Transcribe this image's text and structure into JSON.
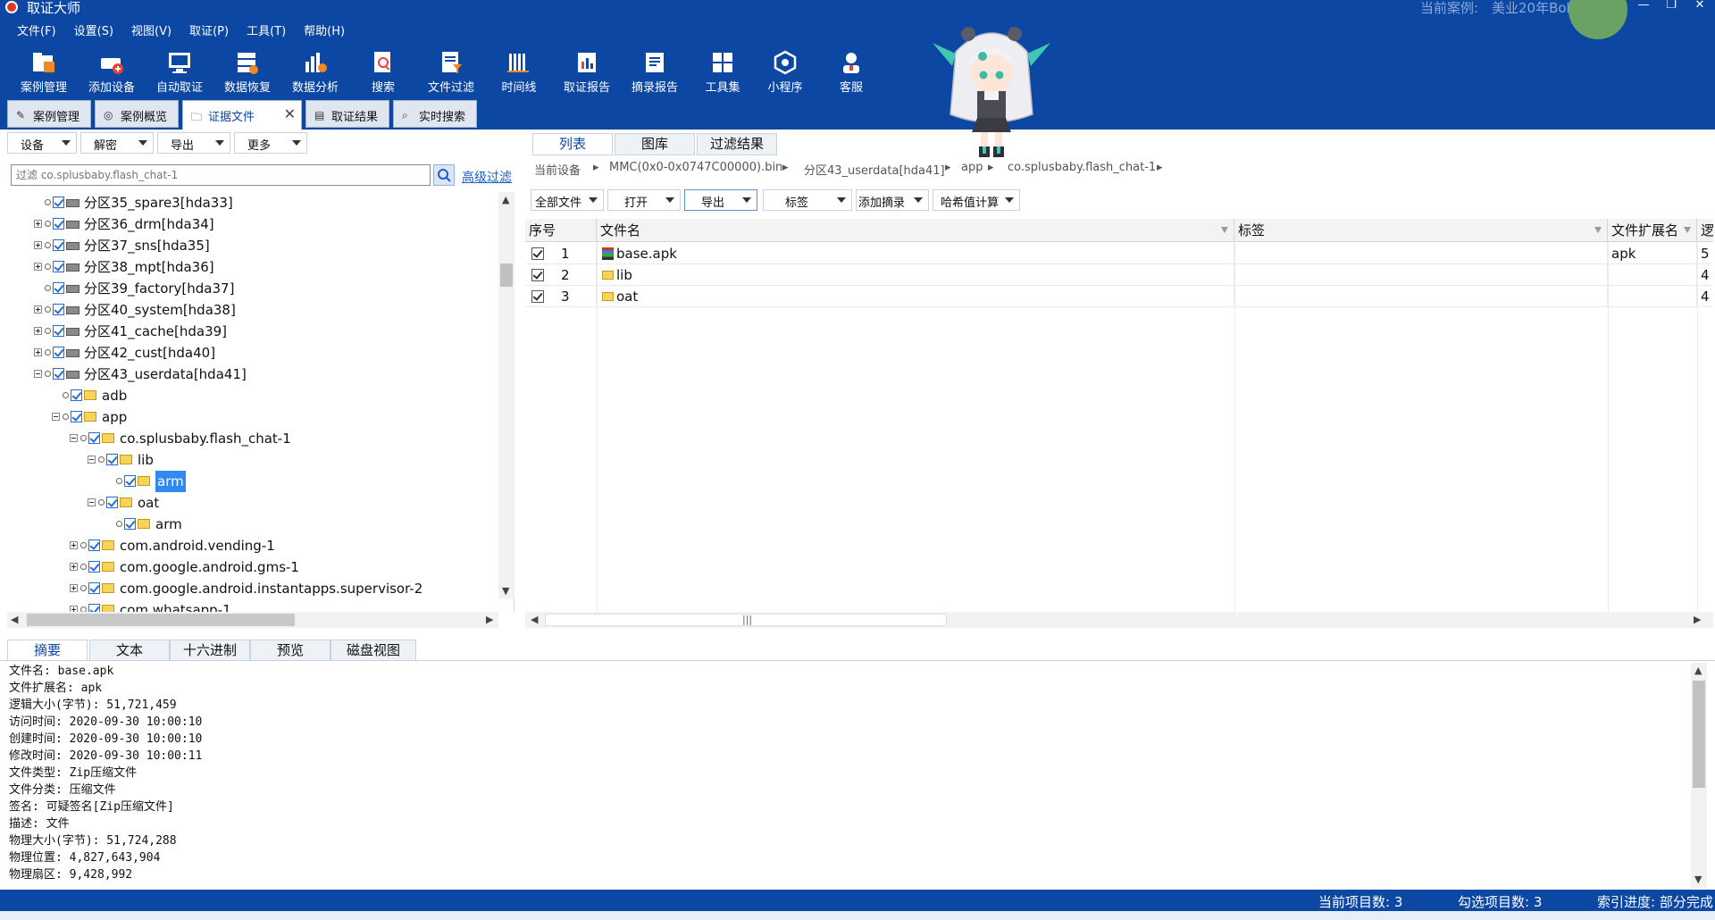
{
  "window": {
    "title": "取证大师",
    "case_label": "当前案例:",
    "case_name": "美业20年Bob手机",
    "minimize": "—",
    "restore": "❐",
    "close": "✕"
  },
  "menu": [
    "文件(F)",
    "设置(S)",
    "视图(V)",
    "取证(P)",
    "工具(T)",
    "帮助(H)"
  ],
  "toolbar": [
    {
      "label": "案例管理",
      "icon": "case-folder-icon"
    },
    {
      "label": "添加设备",
      "icon": "add-device-icon"
    },
    {
      "label": "自动取证",
      "icon": "auto-forensics-icon"
    },
    {
      "label": "数据恢复",
      "icon": "data-recovery-icon"
    },
    {
      "label": "数据分析",
      "icon": "data-analysis-icon"
    },
    {
      "label": "搜索",
      "icon": "search-doc-icon"
    },
    {
      "label": "文件过滤",
      "icon": "file-filter-icon"
    },
    {
      "label": "时间线",
      "icon": "timeline-icon"
    },
    {
      "label": "取证报告",
      "icon": "report-icon"
    },
    {
      "label": "摘录报告",
      "icon": "excerpt-report-icon"
    },
    {
      "label": "工具集",
      "icon": "toolset-icon"
    },
    {
      "label": "小程序",
      "icon": "miniprogram-icon"
    },
    {
      "label": "客服",
      "icon": "customer-service-icon"
    }
  ],
  "main_tabs": [
    {
      "label": "案例管理",
      "active": false
    },
    {
      "label": "案例概览",
      "active": false
    },
    {
      "label": "证据文件",
      "active": true,
      "closable": "✕"
    },
    {
      "label": "取证结果",
      "active": false
    },
    {
      "label": "实时搜索",
      "active": false
    }
  ],
  "left_tools": [
    "设备",
    "解密",
    "导出",
    "更多"
  ],
  "filter": {
    "placeholder": "过滤 co.splusbaby.flash_chat-1",
    "advanced": "高级过滤"
  },
  "tree": [
    {
      "label": "分区35_spare3[hda33]",
      "level": 0,
      "expander": "none",
      "kind": "disk"
    },
    {
      "label": "分区36_drm[hda34]",
      "level": 0,
      "expander": "plus",
      "kind": "disk"
    },
    {
      "label": "分区37_sns[hda35]",
      "level": 0,
      "expander": "plus",
      "kind": "disk"
    },
    {
      "label": "分区38_mpt[hda36]",
      "level": 0,
      "expander": "plus",
      "kind": "disk"
    },
    {
      "label": "分区39_factory[hda37]",
      "level": 0,
      "expander": "none",
      "kind": "disk"
    },
    {
      "label": "分区40_system[hda38]",
      "level": 0,
      "expander": "plus",
      "kind": "disk"
    },
    {
      "label": "分区41_cache[hda39]",
      "level": 0,
      "expander": "plus",
      "kind": "disk"
    },
    {
      "label": "分区42_cust[hda40]",
      "level": 0,
      "expander": "plus",
      "kind": "disk"
    },
    {
      "label": "分区43_userdata[hda41]",
      "level": 0,
      "expander": "minus",
      "kind": "disk"
    },
    {
      "label": "adb",
      "level": 1,
      "expander": "none",
      "kind": "folder"
    },
    {
      "label": "app",
      "level": 1,
      "expander": "minus",
      "kind": "folder"
    },
    {
      "label": "co.splusbaby.flash_chat-1",
      "level": 2,
      "expander": "minus",
      "kind": "folder"
    },
    {
      "label": "lib",
      "level": 3,
      "expander": "minus",
      "kind": "folder"
    },
    {
      "label": "arm",
      "level": 4,
      "expander": "none",
      "kind": "folder",
      "selected": true
    },
    {
      "label": "oat",
      "level": 3,
      "expander": "minus",
      "kind": "folder"
    },
    {
      "label": "arm",
      "level": 4,
      "expander": "none",
      "kind": "folder"
    },
    {
      "label": "com.android.vending-1",
      "level": 2,
      "expander": "plus",
      "kind": "folder"
    },
    {
      "label": "com.google.android.gms-1",
      "level": 2,
      "expander": "plus",
      "kind": "folder"
    },
    {
      "label": "com.google.android.instantapps.supervisor-2",
      "level": 2,
      "expander": "plus",
      "kind": "folder"
    },
    {
      "label": "com.whatsapp-1",
      "level": 2,
      "expander": "plus",
      "kind": "folder"
    }
  ],
  "right_tabs": [
    {
      "label": "列表",
      "active": true
    },
    {
      "label": "图库",
      "active": false
    },
    {
      "label": "过滤结果",
      "active": false
    }
  ],
  "breadcrumb": [
    "当前设备",
    "MMC(0x0-0x0747C00000).bin",
    "分区43_userdata[hda41]",
    "app",
    "co.splusbaby.flash_chat-1"
  ],
  "breadcrumb_sep": "▸",
  "right_tools": [
    "全部文件",
    "打开",
    "导出",
    "标签",
    "添加摘录",
    "哈希值计算"
  ],
  "grid": {
    "headers": [
      "序号",
      "文件名",
      "标签",
      "文件扩展名",
      "逻"
    ],
    "rows": [
      {
        "no": "1",
        "name": "base.apk",
        "icon": "archive-file-icon",
        "tag": "",
        "ext": "apk",
        "extra": "5"
      },
      {
        "no": "2",
        "name": "lib",
        "icon": "folder-icon",
        "tag": "",
        "ext": "",
        "extra": "4"
      },
      {
        "no": "3",
        "name": "oat",
        "icon": "folder-icon",
        "tag": "",
        "ext": "",
        "extra": "4"
      }
    ]
  },
  "bottom_tabs": [
    {
      "label": "摘要",
      "active": true
    },
    {
      "label": "文本",
      "active": false
    },
    {
      "label": "十六进制",
      "active": false
    },
    {
      "label": "预览",
      "active": false
    },
    {
      "label": "磁盘视图",
      "active": false
    }
  ],
  "summary": [
    "文件名: base.apk",
    "文件扩展名: apk",
    "逻辑大小(字节): 51,721,459",
    "访问时间: 2020-09-30 10:00:10",
    "创建时间: 2020-09-30 10:00:10",
    "修改时间: 2020-09-30 10:00:11",
    "文件类型: Zip压缩文件",
    "文件分类: 压缩文件",
    "签名: 可疑签名[Zip压缩文件]",
    "描述: 文件",
    "物理大小(字节): 51,724,288",
    "物理位置: 4,827,643,904",
    "物理扇区: 9,428,992"
  ],
  "status": {
    "current_items": "当前项目数: 3",
    "checked_items": "勾选项目数: 3",
    "index_progress": "索引进度: 部分完成"
  },
  "colors": {
    "brand": "#0b47a3",
    "selection": "#3389f0",
    "link": "#1b5ec8"
  }
}
